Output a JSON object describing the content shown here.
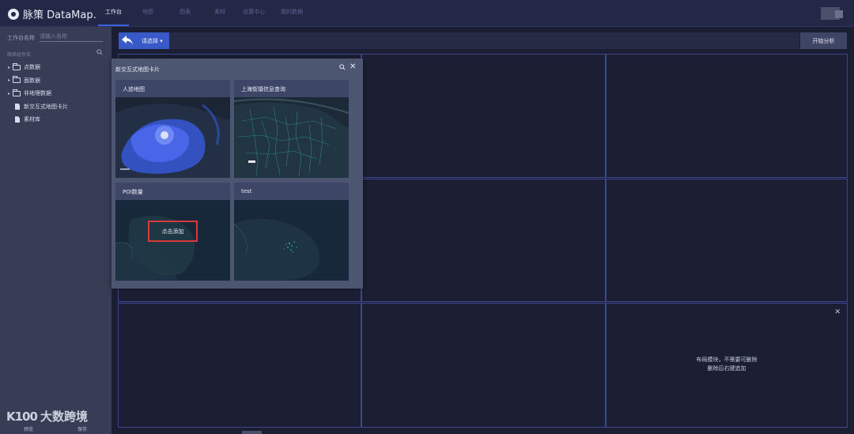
{
  "app": {
    "logo_text": "脉策 DataMap."
  },
  "nav": {
    "items": [
      {
        "label": "工作台",
        "active": true
      },
      {
        "label": "地图",
        "active": false
      },
      {
        "label": "图表",
        "active": false
      },
      {
        "label": "素材",
        "active": false
      },
      {
        "label": "设置中心",
        "active": false
      },
      {
        "label": "我的数据",
        "active": false
      }
    ]
  },
  "sidebar": {
    "workspace_label": "工作台名称",
    "workspace_placeholder": "请输入名称",
    "library_label": "图表组件库",
    "tree": [
      {
        "label": "点数据",
        "kind": "folder"
      },
      {
        "label": "面数据",
        "kind": "folder"
      },
      {
        "label": "非地理数据",
        "kind": "folder"
      },
      {
        "label": "新交互式地图卡片",
        "kind": "doc"
      },
      {
        "label": "素材库",
        "kind": "doc"
      }
    ],
    "bottom": {
      "left": "预览",
      "right": "保存"
    }
  },
  "toolbar": {
    "select_label": "请选择",
    "analyze_label": "开始分析"
  },
  "panel": {
    "title": "新交互式地图卡片",
    "cards": [
      {
        "title": "人迹地图"
      },
      {
        "title": "上海街镇信息查询"
      },
      {
        "title": "POI数量"
      },
      {
        "title": "test"
      }
    ],
    "add_label": "点击添加"
  },
  "layout_block": {
    "line1": "布局模块，不需要可删除",
    "line2": "删除后右键追加"
  },
  "watermark": {
    "icon_text": "K100",
    "text": "大数跨境"
  },
  "colors": {
    "accent": "#3a59c9",
    "grid_line": "#3d4790",
    "highlight": "#d93a3a"
  }
}
